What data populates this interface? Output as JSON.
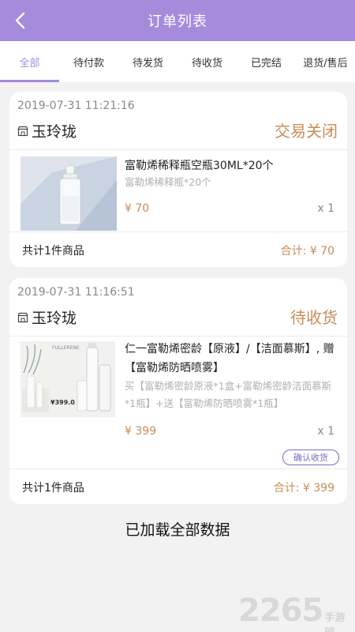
{
  "header": {
    "title": "订单列表"
  },
  "tabs": [
    {
      "label": "全部",
      "active": true
    },
    {
      "label": "待付款"
    },
    {
      "label": "待发货"
    },
    {
      "label": "待收货"
    },
    {
      "label": "已完结"
    },
    {
      "label": "退货/售后"
    }
  ],
  "orders": [
    {
      "date": "2019-07-31 11:21:16",
      "shop": "玉玲珑",
      "status": "交易关闭",
      "item": {
        "title": "富勒烯稀释瓶空瓶30ML*20个",
        "desc": "富勒烯稀释瓶*20个",
        "price": "¥ 70",
        "qty": "x 1"
      },
      "footer": {
        "count": "共计1件商品",
        "total": "合计: ¥ 70"
      }
    },
    {
      "date": "2019-07-31 11:16:51",
      "shop": "玉玲珑",
      "status": "待收货",
      "item": {
        "title": "仁一富勒烯密龄【原液】/【洁面慕斯】, 赠【富勒烯防晒喷雾】",
        "desc": "买【富勒烯密龄原液*1盒+富勒烯密龄洁面慕斯*1瓶】+送【富勒烯防晒喷雾*1瓶】",
        "price": "¥ 399",
        "qty": "x 1",
        "product_image_text": {
          "brand": "FULLERENE",
          "price": "¥399.0"
        }
      },
      "action": "确认收货",
      "footer": {
        "count": "共计1件商品",
        "total": "合计: ¥ 399"
      }
    }
  ],
  "load_status": "已加载全部数据",
  "watermark": {
    "number": "2265",
    "text": "手游网"
  },
  "colors": {
    "accent": "#a48bdc",
    "status": "#c98c5a",
    "button_border": "#7b69c6"
  }
}
